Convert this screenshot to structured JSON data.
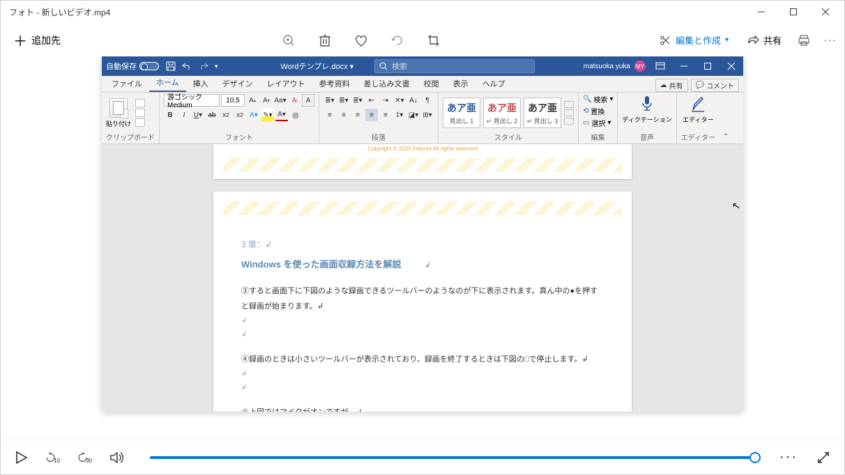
{
  "photos": {
    "window_title": "フォト - 新しいビデオ.mp4",
    "add_label": "追加先",
    "edit_create_label": "編集と作成",
    "share_label": "共有"
  },
  "playback": {
    "skip_back": "10",
    "skip_fwd": "30"
  },
  "word": {
    "autosave_label": "自動保存",
    "autosave_state": "オフ",
    "doc_title": "Wordテンプレ.docx ▾",
    "search_placeholder": "検索",
    "user_name": "matsuoka yuka",
    "user_initials": "MY",
    "tabs": {
      "file": "ファイル",
      "home": "ホーム",
      "insert": "挿入",
      "design": "デザイン",
      "layout": "レイアウト",
      "references": "参考資料",
      "mailings": "差し込み文書",
      "review": "校閲",
      "view": "表示",
      "help": "ヘルプ"
    },
    "share_btn": "共有",
    "comment_btn": "コメント",
    "ribbon": {
      "clipboard": {
        "paste": "貼り付け",
        "title": "クリップボード"
      },
      "font": {
        "name": "游ゴシック Medium",
        "size": "10.5",
        "title": "フォント"
      },
      "paragraph": {
        "title": "段落"
      },
      "styles": {
        "title": "スタイル",
        "sample": "あア亜",
        "h1": "見出し 1",
        "h2": "↵ 見出し 2",
        "h3": "↵ 見出し 3"
      },
      "editing": {
        "find": "検索",
        "replace": "置換",
        "select": "選択",
        "title": "編集"
      },
      "voice": {
        "label": "ディクテーション",
        "title": "音声"
      },
      "editor": {
        "label": "エディター",
        "title": "エディター"
      }
    },
    "document": {
      "copyright": "Copyright © 2020 Internet All rights reserved",
      "chapter_num": "3 章：↲",
      "chapter_title": "Windows を使った画面収録方法を解説",
      "para1": "③すると画面下に下図のような録画できるツールバーのようなのが下に表示されます。真ん中の●を押すと録画が始まります。↲",
      "para2": "④録画のときは小さいツールバーが表示されており、録画を終了するときは下図の□で停止します。↲",
      "note": "※上図ではマイクがオンですが、↲",
      "arrow_marker": "↲"
    }
  }
}
